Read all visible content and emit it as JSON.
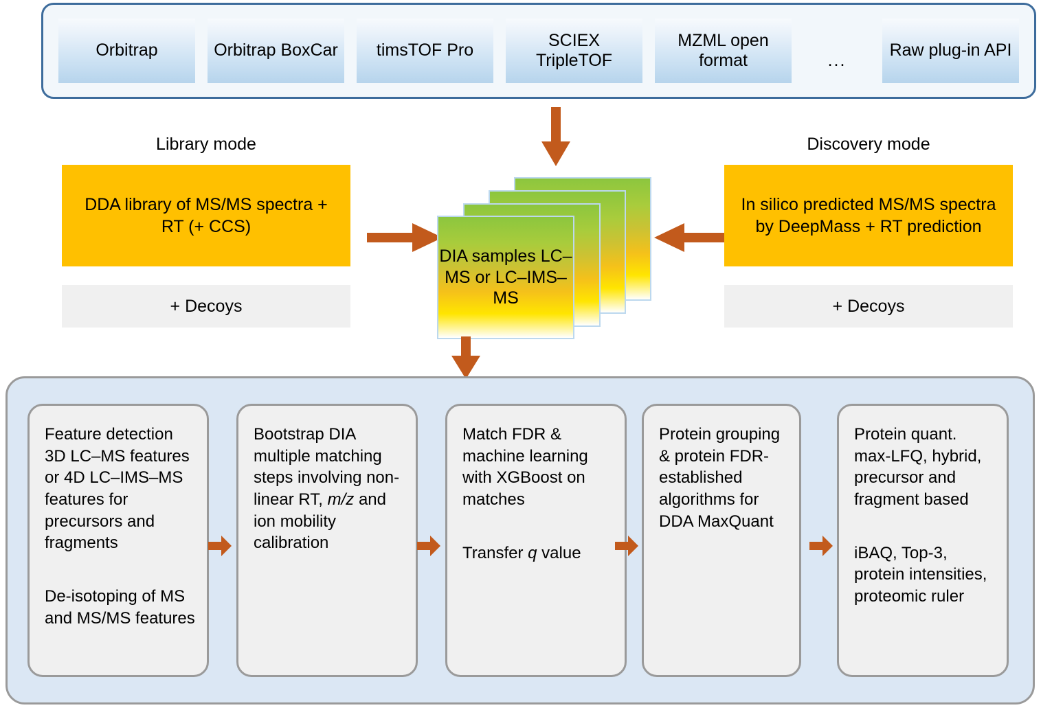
{
  "colors": {
    "accent_orange": "#C25A1C",
    "mode_box_fill": "#FFC000",
    "panel_blue": "#DBE7F4",
    "top_border_blue": "#3D6C9C",
    "box_border_gray": "#9A9A9A",
    "step_box_fill": "#F0F0F0"
  },
  "instrument_bar": {
    "items": [
      {
        "label": "Orbitrap"
      },
      {
        "label": "Orbitrap BoxCar"
      },
      {
        "label": "timsTOF Pro"
      },
      {
        "label": "SCIEX TripleTOF"
      },
      {
        "label": "MZML open format"
      },
      {
        "label": "Raw plug-in API"
      }
    ],
    "ellipsis": "..."
  },
  "library_mode": {
    "title": "Library mode",
    "box_text": "DDA library of MS/MS spectra + RT (+ CCS)",
    "decoys": "+ Decoys"
  },
  "discovery_mode": {
    "title": "Discovery mode",
    "box_text": "In silico predicted MS/MS spectra by DeepMass + RT prediction",
    "decoys": "+ Decoys"
  },
  "dia_samples": {
    "label": "DIA samples LC–MS or LC–IMS–MS",
    "card_count": 4
  },
  "pipeline": {
    "steps": [
      {
        "id": "feature-detection",
        "paragraphs": [
          "Feature detection 3D LC–MS features or 4D LC–IMS–MS features for precursors and fragments",
          "De-isotoping of MS and MS/MS features"
        ]
      },
      {
        "id": "bootstrap-dia",
        "paragraphs": [
          "Bootstrap DIA multiple matching steps involving non-linear RT, m/z and ion mobility calibration"
        ],
        "italic_terms": [
          "m/z"
        ]
      },
      {
        "id": "match-fdr",
        "paragraphs": [
          "Match FDR & machine learning with XGBoost on matches",
          "Transfer q value"
        ],
        "italic_terms": [
          "q"
        ]
      },
      {
        "id": "protein-grouping",
        "paragraphs": [
          "Protein grouping & protein FDR-established algorithms for DDA MaxQuant"
        ]
      },
      {
        "id": "protein-quant",
        "paragraphs": [
          "Protein quant. max-LFQ, hybrid, precursor and fragment based",
          "iBAQ, Top-3, protein intensities, proteomic ruler"
        ]
      }
    ]
  }
}
